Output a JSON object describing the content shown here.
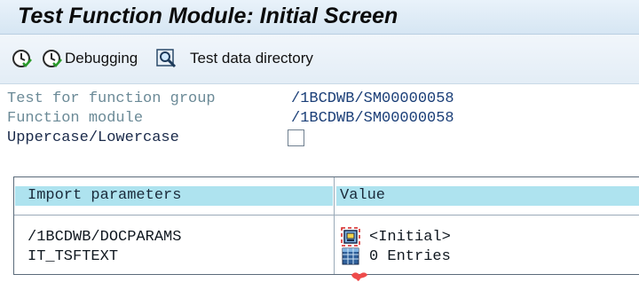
{
  "window": {
    "title": "Test Function Module: Initial Screen"
  },
  "toolbar": {
    "execute_icon": "clock-check-icon",
    "debugging_label": "Debugging",
    "test_data_directory_label": "Test data directory"
  },
  "form": {
    "function_group_label": "Test for function group",
    "function_group_value": "/1BCDWB/SM00000058",
    "function_module_label": "Function module",
    "function_module_value": "/1BCDWB/SM00000058",
    "uppercase_label": "Uppercase/Lowercase",
    "uppercase_checked": false
  },
  "table": {
    "headers": [
      "Import parameters",
      "Value"
    ],
    "rows": [
      {
        "param": "/1BCDWB/DOCPARAMS",
        "value": "<Initial>",
        "icon": "structure-icon"
      },
      {
        "param": "IT_TSFTEXT",
        "value": "0 Entries",
        "icon": "table-icon"
      }
    ]
  },
  "colors": {
    "title_bar": "#d6e6f3",
    "header_cell": "#aee3ef",
    "value_text": "#1b3f78"
  }
}
